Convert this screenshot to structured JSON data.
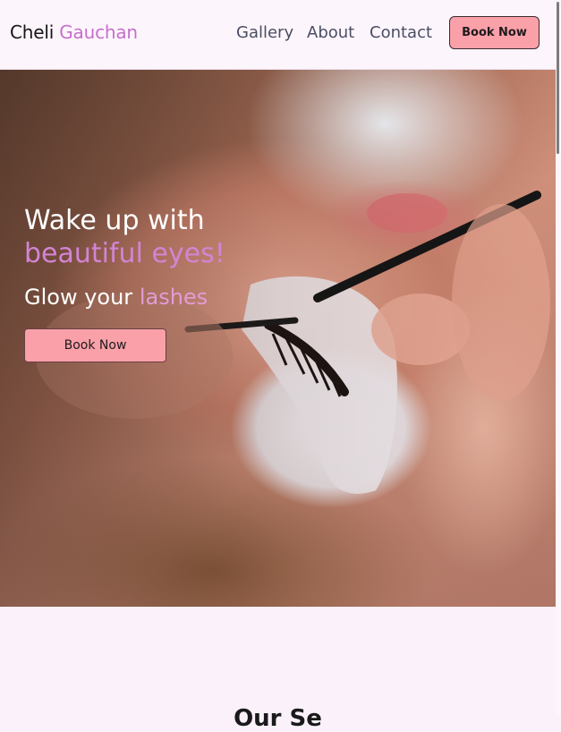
{
  "nav": {
    "brand_first": "Cheli",
    "brand_second": "Gauchan",
    "links": [
      "Gallery",
      "About",
      "Contact"
    ],
    "cta": "Book Now"
  },
  "hero": {
    "title_line1": "Wake up with",
    "title_line2": "beautiful eyes!",
    "subtitle_plain": "Glow your",
    "subtitle_accent": "lashes",
    "cta": "Book Now"
  },
  "section": {
    "heading": "Our Se"
  },
  "colors": {
    "accent": "#c570cb",
    "button": "#f9a0a9",
    "page_bg": "#fbf1fb"
  }
}
